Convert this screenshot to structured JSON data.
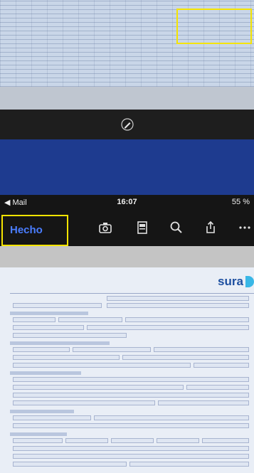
{
  "status_bar": {
    "back_label": "◀ Mail",
    "time": "16:07",
    "battery": "55 %"
  },
  "toolbar": {
    "done_label": "Hecho"
  },
  "document": {
    "logo": "sura"
  },
  "icons": [
    "pencil-icon",
    "camera-icon",
    "document-scan-icon",
    "search-icon",
    "share-icon",
    "more-icon"
  ],
  "colors": {
    "highlight": "#f5e400",
    "band": "#1e3b8f",
    "link": "#4a7dff",
    "logo": "#1d4fa0"
  }
}
